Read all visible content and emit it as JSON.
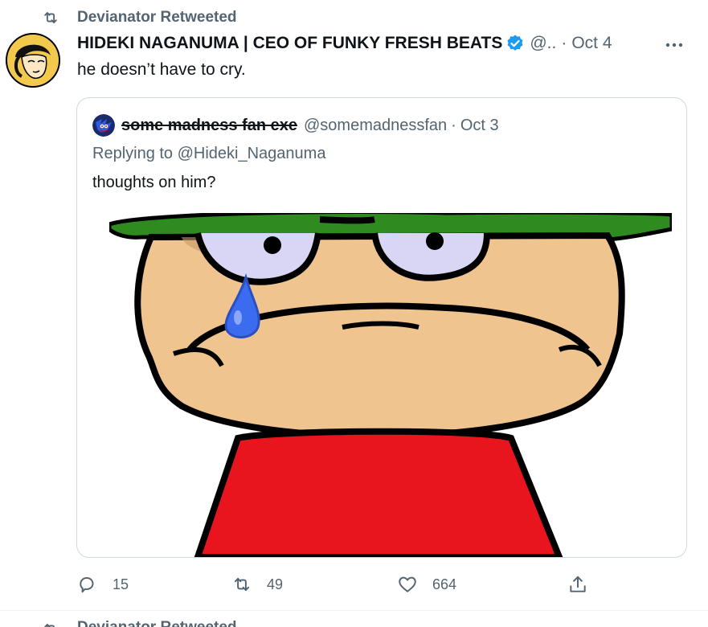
{
  "retweet": {
    "label": "Devianator Retweeted"
  },
  "tweet": {
    "author_name": "HIDEKI NAGANUMA | CEO OF FUNKY FRESH BEATS",
    "handle": "@..",
    "dot": "·",
    "time": "Oct 4",
    "text": "he doesn’t have to cry."
  },
  "quote": {
    "author_name": "some madness fan exe",
    "handle": "@somemadnessfan",
    "dot": "·",
    "time": "Oct 3",
    "replying_to": "Replying to @Hideki_Naganuma",
    "text": "thoughts on him?"
  },
  "actions": {
    "replies": "15",
    "retweets": "49",
    "likes": "664"
  },
  "next": {
    "label": "Devianator Retweeted"
  },
  "colors": {
    "verified": "#1d9bf0",
    "secondary_text": "#536471",
    "border": "#cfd9de"
  },
  "icons": [
    "retweet-icon",
    "verified-icon",
    "more-icon",
    "reply-icon",
    "like-icon",
    "share-icon"
  ]
}
